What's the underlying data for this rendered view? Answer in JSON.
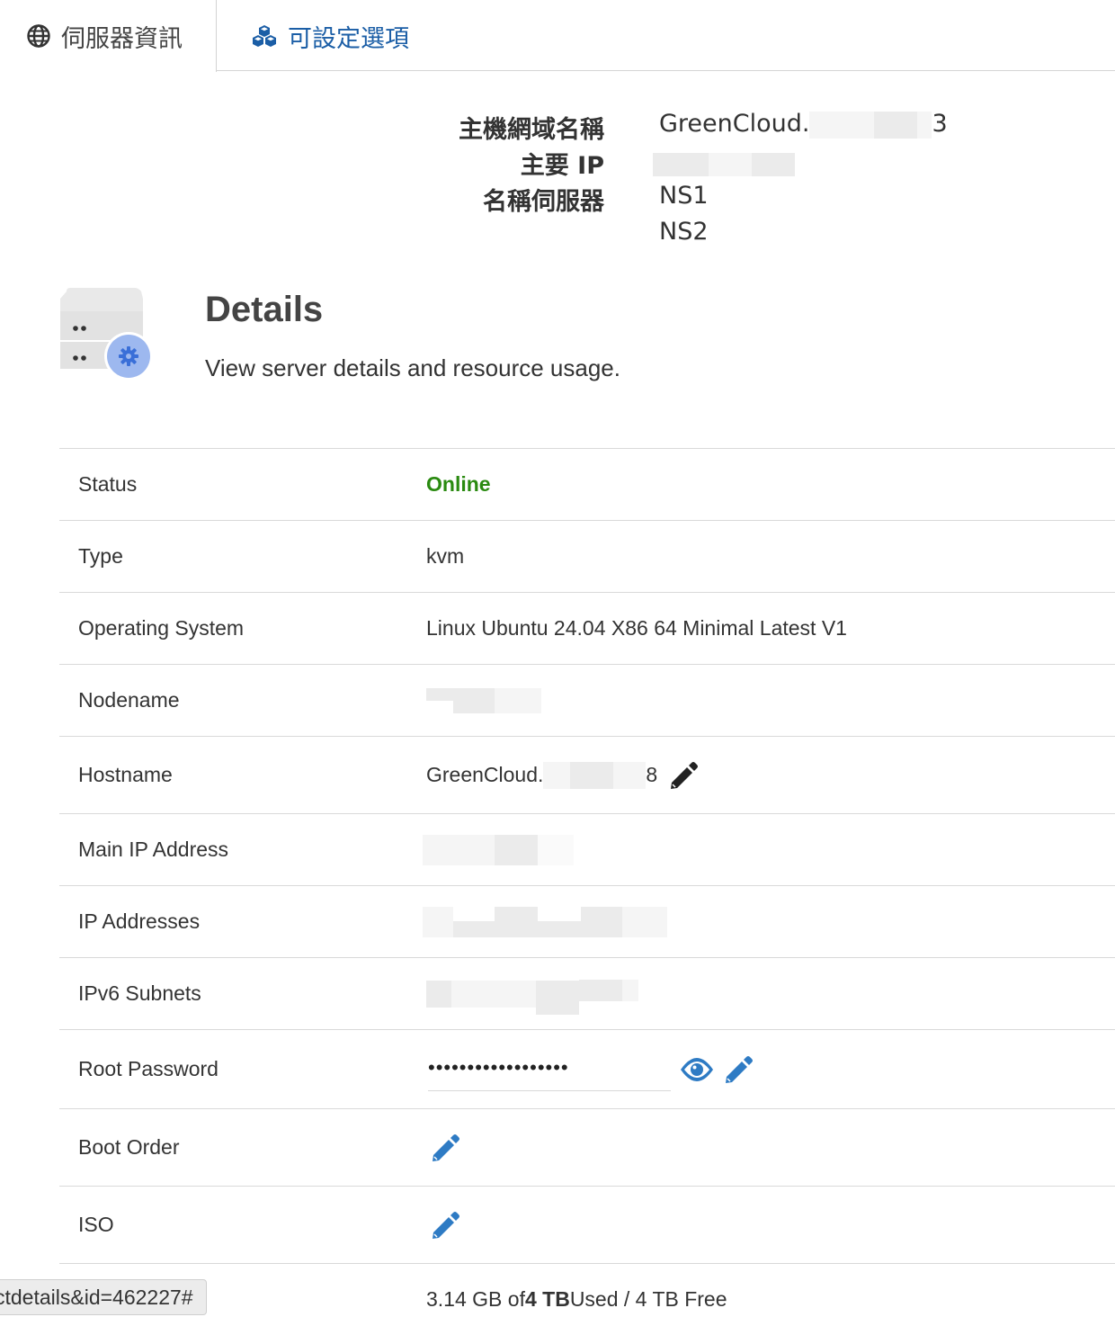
{
  "tabs": {
    "server_info": "伺服器資訊",
    "configurable_options": "可設定選項"
  },
  "server_info": {
    "hostname_label": "主機網域名稱",
    "hostname_value": "GreenCloud.",
    "hostname_suffix": "3",
    "main_ip_label": "主要 IP",
    "nameservers_label": "名稱伺服器",
    "ns1": "NS1",
    "ns2": "NS2"
  },
  "details": {
    "title": "Details",
    "subtitle": "View server details and resource usage."
  },
  "table": {
    "status_label": "Status",
    "status_value": "Online",
    "type_label": "Type",
    "type_value": "kvm",
    "os_label": "Operating System",
    "os_value": "Linux Ubuntu 24.04 X86 64 Minimal Latest V1",
    "nodename_label": "Nodename",
    "hostname_label": "Hostname",
    "hostname_value": "GreenCloud.",
    "hostname_suffix": "8",
    "main_ip_label": "Main IP Address",
    "ip_addresses_label": "IP Addresses",
    "ipv6_label": "IPv6 Subnets",
    "root_password_label": "Root Password",
    "root_password_value": "••••••••••••••••••",
    "boot_order_label": "Boot Order",
    "iso_label": "ISO",
    "bandwidth_used": "3.14 GB of ",
    "bandwidth_total": "4 TB",
    "bandwidth_rest": " Used / 4 TB Free"
  },
  "status_bar": {
    "url_fragment": "ctdetails&id=462227#"
  },
  "colors": {
    "link_blue": "#1b5ea6",
    "icon_blue": "#2e7bc4",
    "online_green": "#2a8a10"
  }
}
